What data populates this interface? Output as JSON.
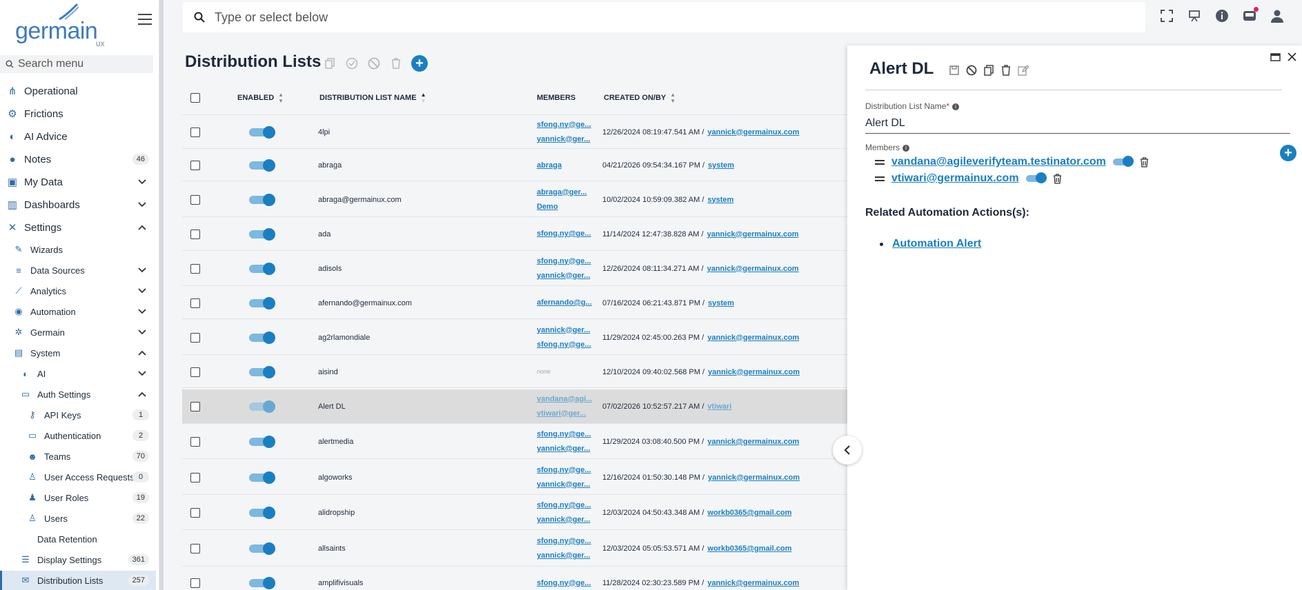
{
  "app": {
    "logo_text": "germain",
    "logo_sub": "UX"
  },
  "sidebar": {
    "search_placeholder": "Search menu",
    "items": [
      {
        "label": "Operational",
        "icon": "sitemap-icon",
        "level": 0
      },
      {
        "label": "Frictions",
        "icon": "friction-icon",
        "level": 0
      },
      {
        "label": "AI Advice",
        "icon": "brain-icon",
        "level": 0
      },
      {
        "label": "Notes",
        "icon": "comment-icon",
        "level": 0,
        "count": "46"
      },
      {
        "label": "My Data",
        "icon": "save-icon",
        "level": 0,
        "chevron": "down"
      },
      {
        "label": "Dashboards",
        "icon": "chart-icon",
        "level": 0,
        "chevron": "down"
      },
      {
        "label": "Settings",
        "icon": "tools-icon",
        "level": 0,
        "chevron": "up"
      },
      {
        "label": "Wizards",
        "icon": "wand-icon",
        "level": 1
      },
      {
        "label": "Data Sources",
        "icon": "database-icon",
        "level": 1,
        "chevron": "down"
      },
      {
        "label": "Analytics",
        "icon": "line-chart-icon",
        "level": 1,
        "chevron": "down"
      },
      {
        "label": "Automation",
        "icon": "robot-icon",
        "level": 1,
        "chevron": "down"
      },
      {
        "label": "Germain",
        "icon": "cogs-icon",
        "level": 1,
        "chevron": "down"
      },
      {
        "label": "System",
        "icon": "server-icon",
        "level": 1,
        "chevron": "up"
      },
      {
        "label": "AI",
        "icon": "brain-icon",
        "level": 2,
        "chevron": "down"
      },
      {
        "label": "Auth Settings",
        "icon": "id-card-icon",
        "level": 2,
        "chevron": "up"
      },
      {
        "label": "API Keys",
        "icon": "key-icon",
        "level": 3,
        "count": "1"
      },
      {
        "label": "Authentication",
        "icon": "id-card-icon",
        "level": 3,
        "count": "2"
      },
      {
        "label": "Teams",
        "icon": "users-icon",
        "level": 3,
        "count": "70"
      },
      {
        "label": "User Access Requests",
        "icon": "user-plus-icon",
        "level": 3,
        "count": "0"
      },
      {
        "label": "User Roles",
        "icon": "users-cog-icon",
        "level": 3,
        "count": "19"
      },
      {
        "label": "Users",
        "icon": "user-icon",
        "level": 3,
        "count": "22"
      },
      {
        "label": "Data Retention",
        "icon": "",
        "level": 2
      },
      {
        "label": "Display Settings",
        "icon": "list-icon",
        "level": 2,
        "count": "361"
      },
      {
        "label": "Distribution Lists",
        "icon": "mail-list-icon",
        "level": 2,
        "count": "257",
        "active": true
      }
    ]
  },
  "topbar": {
    "search_placeholder": "Type or select below"
  },
  "main": {
    "title": "Distribution Lists",
    "columns": {
      "enabled": "ENABLED",
      "name": "DISTRIBUTION LIST NAME",
      "members": "MEMBERS",
      "created": "CREATED ON/BY"
    },
    "rows": [
      {
        "name": "4lpi",
        "members": [
          "sfong.ny@ge...",
          "yannick@ger..."
        ],
        "created": "12/26/2024 08:19:47.541 AM /",
        "by": "yannick@germainux.com"
      },
      {
        "name": "abraga",
        "members": [
          "abraga"
        ],
        "created": "04/21/2026 09:54:34.167 PM /",
        "by": "system"
      },
      {
        "name": "abraga@germainux.com",
        "members": [
          "abraga@ger...",
          "Demo"
        ],
        "created": "10/02/2024 10:59:09.382 AM /",
        "by": "system"
      },
      {
        "name": "ada",
        "members": [
          "sfong.ny@ge..."
        ],
        "created": "11/14/2024 12:47:38.828 AM /",
        "by": "yannick@germainux.com"
      },
      {
        "name": "adisols",
        "members": [
          "sfong.ny@ge...",
          "yannick@ger..."
        ],
        "created": "12/26/2024 08:11:34.271 AM /",
        "by": "yannick@germainux.com"
      },
      {
        "name": "afernando@germainux.com",
        "members": [
          "afernando@g..."
        ],
        "created": "07/16/2024 06:21:43.871 PM /",
        "by": "system"
      },
      {
        "name": "ag2rlamondiale",
        "members": [
          "yannick@ger...",
          "sfong.ny@ge..."
        ],
        "created": "11/29/2024 02:45:00.263 PM /",
        "by": "yannick@germainux.com"
      },
      {
        "name": "aisind",
        "members": [],
        "none_label": "none",
        "created": "12/10/2024 09:40:02.568 PM /",
        "by": "yannick@germainux.com"
      },
      {
        "name": "Alert DL",
        "members": [
          "vandana@agi...",
          "vtiwari@ger..."
        ],
        "created": "07/02/2026 10:52:57.217 AM /",
        "by": "vtiwari",
        "selected": true
      },
      {
        "name": "alertmedia",
        "members": [
          "sfong.ny@ge...",
          "yannick@ger..."
        ],
        "created": "11/29/2024 03:08:40.500 PM /",
        "by": "yannick@germainux.com"
      },
      {
        "name": "algoworks",
        "members": [
          "sfong.ny@ge...",
          "yannick@ger..."
        ],
        "created": "12/16/2024 01:50:30.148 PM /",
        "by": "yannick@germainux.com"
      },
      {
        "name": "alidropship",
        "members": [
          "sfong.ny@ge...",
          "yannick@ger..."
        ],
        "created": "12/03/2024 04:50:43.348 AM /",
        "by": "workb0365@gmail.com"
      },
      {
        "name": "allsaints",
        "members": [
          "sfong.ny@ge...",
          "yannick@ger..."
        ],
        "created": "12/03/2024 05:05:53.571 AM /",
        "by": "workb0365@gmail.com"
      },
      {
        "name": "amplifivisuals",
        "members": [
          "sfong.ny@ge..."
        ],
        "created": "11/28/2024 02:30:23.589 PM /",
        "by": "yannick@germainux.com"
      }
    ]
  },
  "panel": {
    "title": "Alert DL",
    "name_label": "Distribution List Name",
    "name_required": "*",
    "name_value": "Alert DL",
    "members_label": "Members",
    "members": [
      {
        "email": "vandana@agileverifyteam.testinator.com",
        "enabled": true
      },
      {
        "email": "vtiwari@germainux.com",
        "enabled": true
      }
    ],
    "related_title": "Related Automation Actions(s):",
    "related_items": [
      "Automation Alert"
    ]
  },
  "colors": {
    "accent": "#1a7fc1",
    "logo": "#3b7bbf",
    "selected_row": "#dcdcdc",
    "notification": "#e0245e"
  }
}
